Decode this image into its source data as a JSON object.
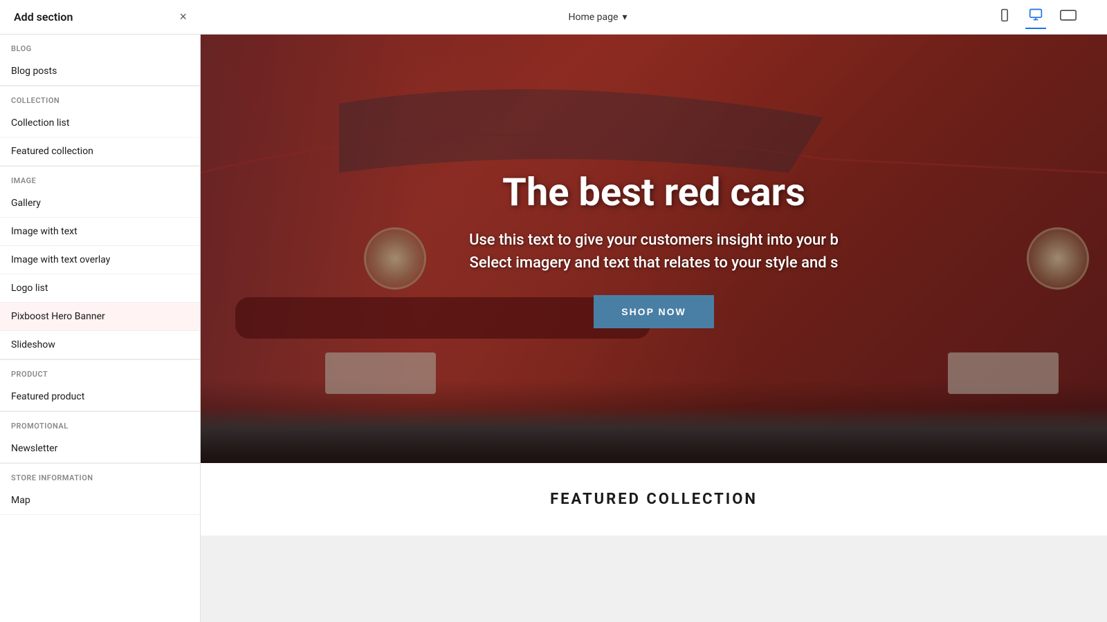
{
  "topbar": {
    "title": "Add section",
    "close_label": "×",
    "page_selector": {
      "label": "Home page",
      "chevron": "▾"
    }
  },
  "view_icons": {
    "mobile": "📱",
    "tablet": "⬜",
    "desktop": "🖥"
  },
  "sidebar": {
    "sections": [
      {
        "category": "BLOG",
        "items": [
          "Blog posts"
        ]
      },
      {
        "category": "COLLECTION",
        "items": [
          "Collection list",
          "Featured collection"
        ]
      },
      {
        "category": "IMAGE",
        "items": [
          "Gallery",
          "Image with text",
          "Image with text overlay",
          "Logo list",
          "Pixboost Hero Banner",
          "Slideshow"
        ]
      },
      {
        "category": "PRODUCT",
        "items": [
          "Featured product"
        ]
      },
      {
        "category": "PROMOTIONAL",
        "items": [
          "Newsletter"
        ]
      },
      {
        "category": "STORE INFORMATION",
        "items": [
          "Map"
        ]
      }
    ]
  },
  "hero": {
    "title": "The best red cars",
    "subtitle_line1": "Use this text to give your customers insight into your b",
    "subtitle_line2": "Select imagery and text that relates to your style and s",
    "cta_label": "SHOP NOW"
  },
  "featured_collection": {
    "title": "FEATURED COLLECTION"
  }
}
